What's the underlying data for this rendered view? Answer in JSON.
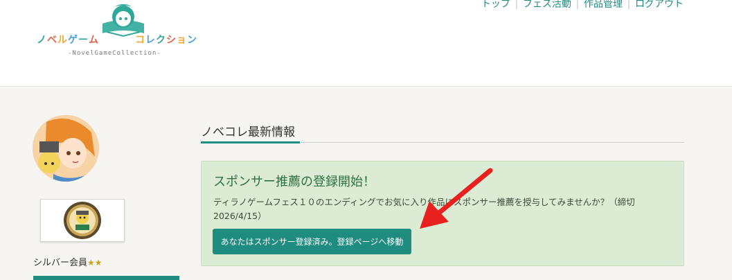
{
  "logo": {
    "text": "ノベルゲームコレクション",
    "text_colors": [
      "#2fa89a",
      "#e0624a",
      "#f0a830",
      "#4aa0d8",
      "#2fa89a",
      "#e0624a",
      "#f0a830",
      "#4aa0d8",
      "#2fa89a",
      "#e0624a",
      "#f0a830",
      "#4aa0d8"
    ],
    "subtitle": "-NovelGameCollection-"
  },
  "nav": {
    "items": [
      "トップ",
      "フェス活動",
      "作品管理",
      "ログアウト"
    ],
    "separator": "|"
  },
  "sidebar": {
    "member_label": "シルバー会員",
    "stars": "★★"
  },
  "main": {
    "section_title": "ノベコレ最新情報",
    "alert": {
      "heading": "スポンサー推薦の登録開始！",
      "body": "ティラノゲームフェス１０のエンディングでお気に入り作品にスポンサー推薦を授与してみませんか？（締切2026/4/15）",
      "button_label": "あなたはスポンサー登録済み。登録ページへ移動"
    }
  },
  "colors": {
    "accent": "#1f8c80",
    "alert_bg": "#dcecd4",
    "alert_heading": "#2f7040",
    "annotation_arrow": "#e8201f"
  },
  "icons": {
    "arrow": "red-pointer-arrow",
    "star": "star-icon"
  }
}
